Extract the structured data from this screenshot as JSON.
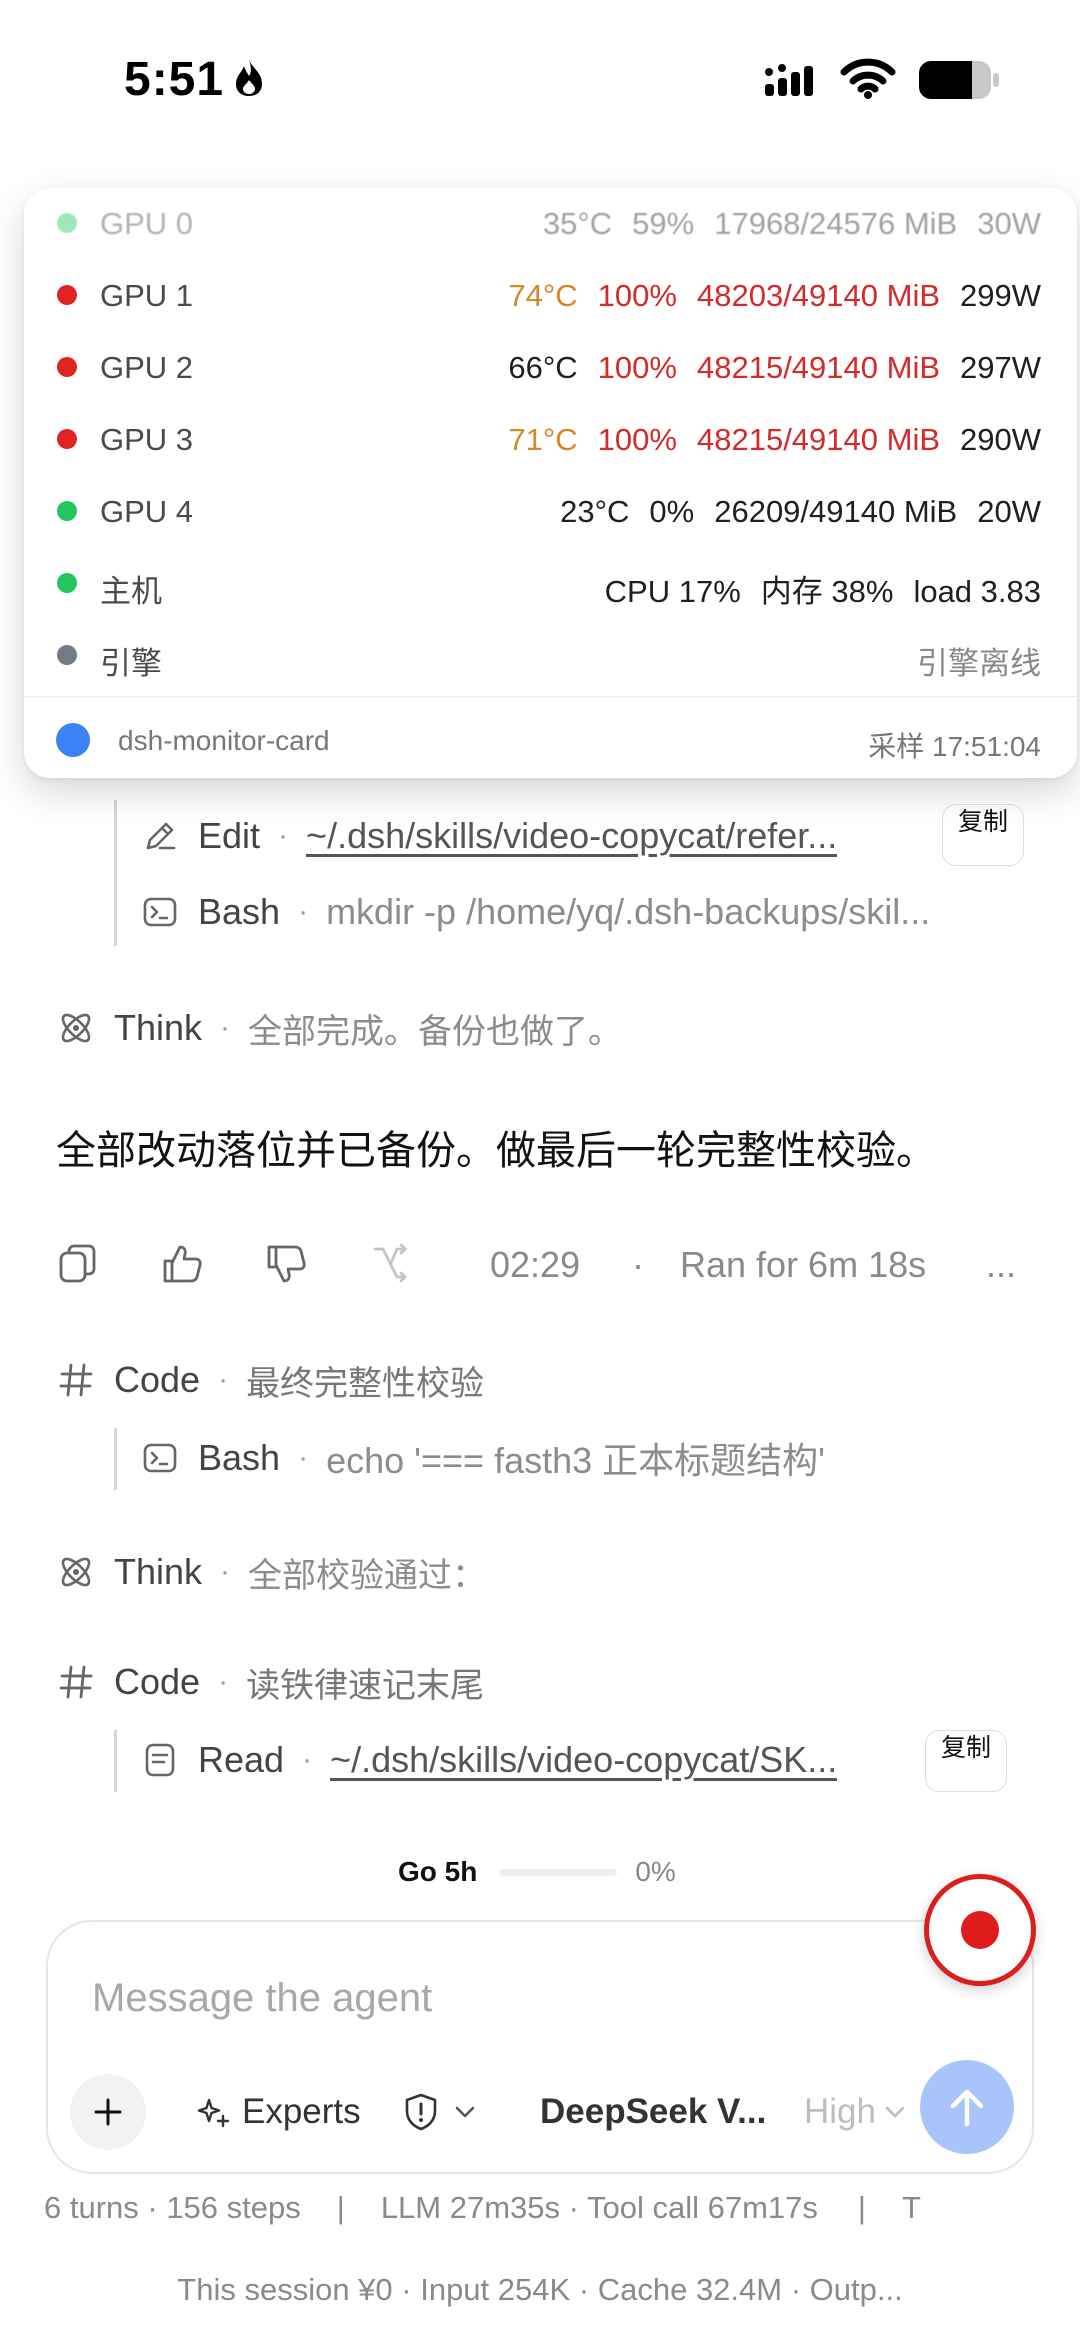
{
  "status_bar": {
    "time": "5:51"
  },
  "monitor": {
    "gpus": [
      {
        "name": "GPU 0",
        "temp": "35°C",
        "util": "59%",
        "mem": "17968/24576 MiB",
        "power": "30W",
        "status_color": "#22c55e"
      },
      {
        "name": "GPU 1",
        "temp": "74°C",
        "util": "100%",
        "mem": "48203/49140 MiB",
        "power": "299W",
        "status_color": "#e02424"
      },
      {
        "name": "GPU 2",
        "temp": "66°C",
        "util": "100%",
        "mem": "48215/49140 MiB",
        "power": "297W",
        "status_color": "#e02424"
      },
      {
        "name": "GPU 3",
        "temp": "71°C",
        "util": "100%",
        "mem": "48215/49140 MiB",
        "power": "290W",
        "status_color": "#e02424"
      },
      {
        "name": "GPU 4",
        "temp": "23°C",
        "util": "0%",
        "mem": "26209/49140 MiB",
        "power": "20W",
        "status_color": "#22c55e"
      }
    ],
    "host": {
      "name": "主机",
      "cpu": "CPU 17%",
      "mem": "内存 38%",
      "load": "load 3.83"
    },
    "engine": {
      "name": "引擎",
      "status": "引擎离线"
    },
    "footer": {
      "name": "dsh-monitor-card",
      "sample_time": "采样 17:51:04"
    }
  },
  "feed": {
    "edit": {
      "label": "Edit",
      "detail": "~/.dsh/skills/video-copycat/refer...",
      "copy_label": "复制"
    },
    "bash1": {
      "label": "Bash",
      "detail": "mkdir -p /home/yq/.dsh-backups/skil..."
    },
    "think1": {
      "label": "Think",
      "detail": "全部完成。备份也做了。"
    },
    "message": "全部改动落位并已备份。做最后一轮完整性校验。",
    "meta": {
      "time": "02:29",
      "dot": "·",
      "duration": "Ran for 6m 18s",
      "more": "..."
    },
    "code1": {
      "label": "Code",
      "detail": "最终完整性校验"
    },
    "bash2": {
      "label": "Bash",
      "detail": "echo '=== fasth3 正本标题结构'"
    },
    "think2": {
      "label": "Think",
      "detail": "全部校验通过："
    },
    "code2": {
      "label": "Code",
      "detail": "读铁律速记末尾"
    },
    "read": {
      "label": "Read",
      "detail": "~/.dsh/skills/video-copycat/SK...",
      "copy_label": "复制"
    },
    "sep": "·"
  },
  "usage": {
    "label": "Go 5h",
    "percent_text": "0%",
    "percent_value": 0
  },
  "composer": {
    "placeholder": "Message the agent",
    "experts_label": "Experts",
    "model_label": "DeepSeek V...",
    "effort_label": "High"
  },
  "stats": {
    "turns": "6 turns · 156 steps",
    "divider": "|",
    "timing": "LLM 27m35s · Tool call 67m17s",
    "trailing": "T",
    "cost": "This session ¥0 · Input 254K · Cache 32.4M · Outp..."
  },
  "colors": {
    "accent": "#3b82f6",
    "danger": "#d42a2a",
    "warning": "#d4882a",
    "ok": "#22c55e",
    "send": "#a8c4fb"
  }
}
